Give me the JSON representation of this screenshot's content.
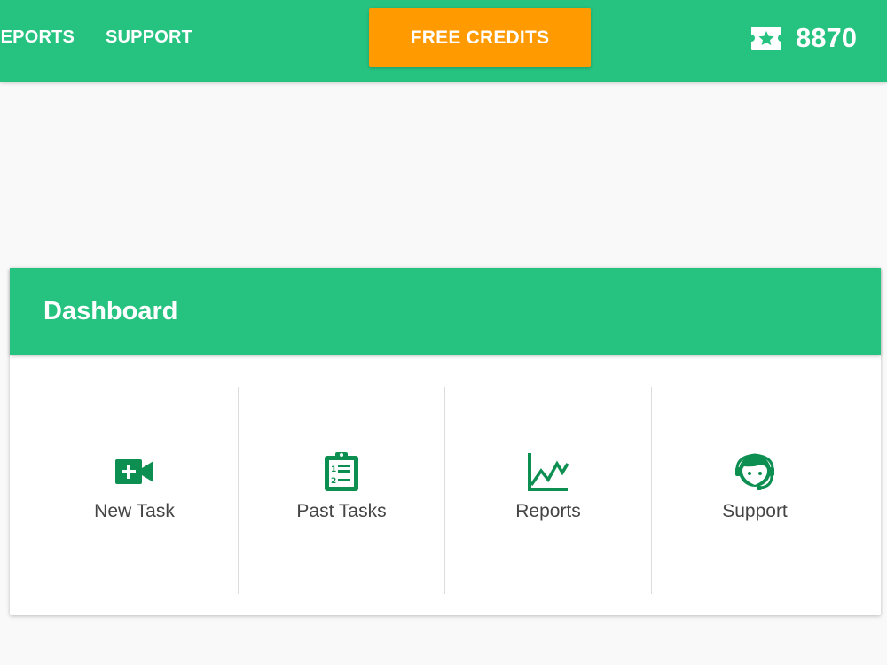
{
  "nav": {
    "reports": "REPORTS",
    "support": "SUPPORT",
    "free_credits": "FREE CREDITS",
    "credits_count": "8870",
    "credits_icon": "ticket-star-icon"
  },
  "dashboard": {
    "title": "Dashboard",
    "tiles": [
      {
        "label": "New Task",
        "icon": "video-add-icon"
      },
      {
        "label": "Past Tasks",
        "icon": "clipboard-list-icon"
      },
      {
        "label": "Reports",
        "icon": "line-chart-icon"
      },
      {
        "label": "Support",
        "icon": "headset-agent-icon"
      }
    ]
  },
  "colors": {
    "brand_green": "#25c280",
    "icon_green": "#0e8f52",
    "cta_orange": "#ff9a00"
  }
}
